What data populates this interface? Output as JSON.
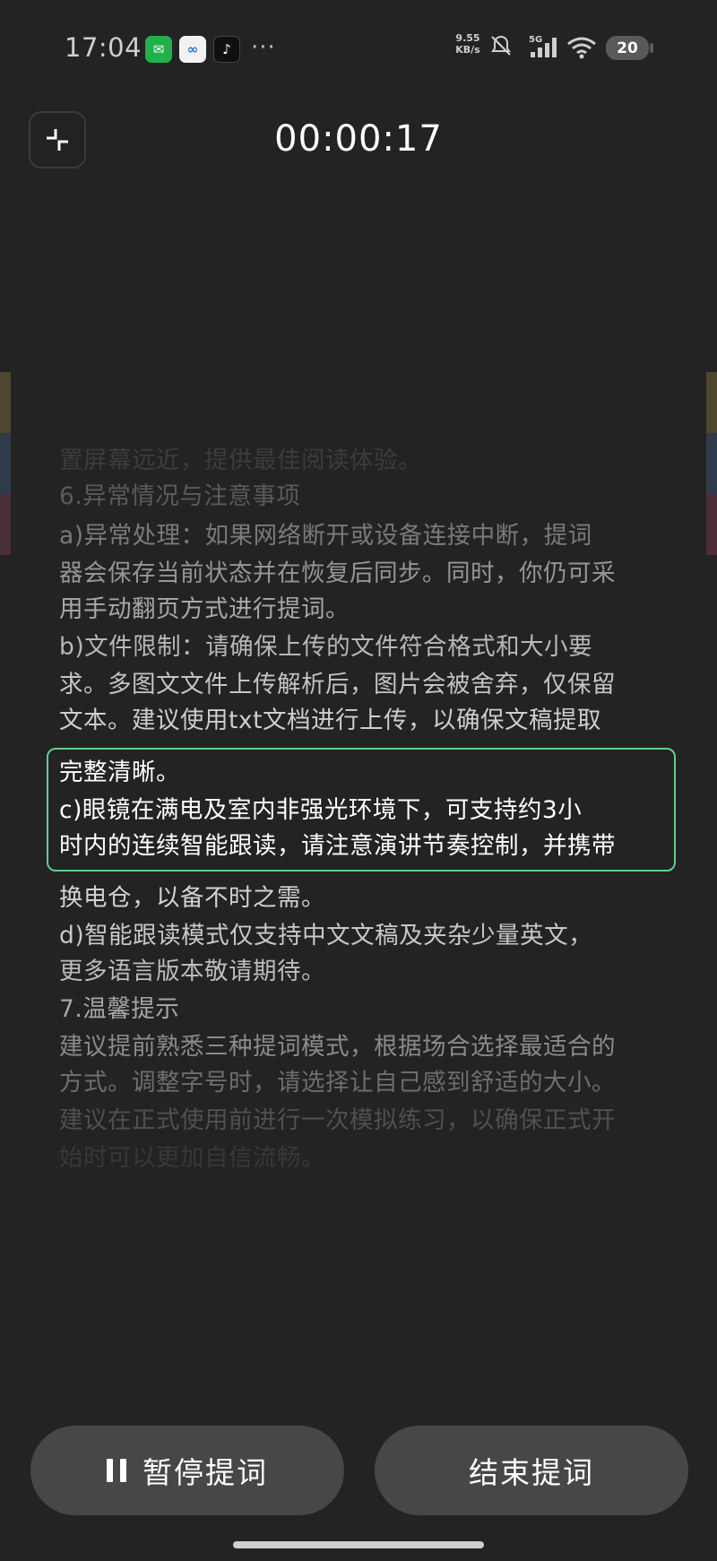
{
  "status_bar": {
    "time": "17:04",
    "net_speed_value": "9.55",
    "net_speed_unit": "KB/s",
    "signal_label": "5G",
    "battery": "20",
    "app_icons": [
      "wechat-icon",
      "loop-icon",
      "douyin-icon"
    ]
  },
  "timer": "00:00:17",
  "teleprompter": {
    "lines": [
      "置屏幕远近，提供最佳阅读体验。",
      "6.异常情况与注意事项",
      "a)异常处理：如果网络断开或设备连接中断，提词",
      "器会保存当前状态并在恢复后同步。同时，你仍可采",
      "用手动翻页方式进行提词。",
      "b)文件限制：请确保上传的文件符合格式和大小要",
      "求。多图文文件上传解析后，图片会被舍弃，仅保留",
      "文本。建议使用txt文档进行上传，以确保文稿提取",
      "完整清晰。",
      "c)眼镜在满电及室内非强光环境下，可支持约3小",
      "时内的连续智能跟读，请注意演讲节奏控制，并携带",
      "换电仓，以备不时之需。",
      "d)智能跟读模式仅支持中文文稿及夹杂少量英文，",
      "更多语言版本敬请期待。",
      "7.温馨提示",
      "建议提前熟悉三种提词模式，根据场合选择最适合的",
      "方式。调整字号时，请选择让自己感到舒适的大小。",
      "建议在正式使用前进行一次模拟练习，以确保正式开",
      "始时可以更加自信流畅。"
    ]
  },
  "buttons": {
    "pause_label": "暂停提词",
    "end_label": "结束提词"
  },
  "colors": {
    "background": "#232323",
    "highlight_border": "#5fcf8c",
    "button_bg": "#474747"
  }
}
